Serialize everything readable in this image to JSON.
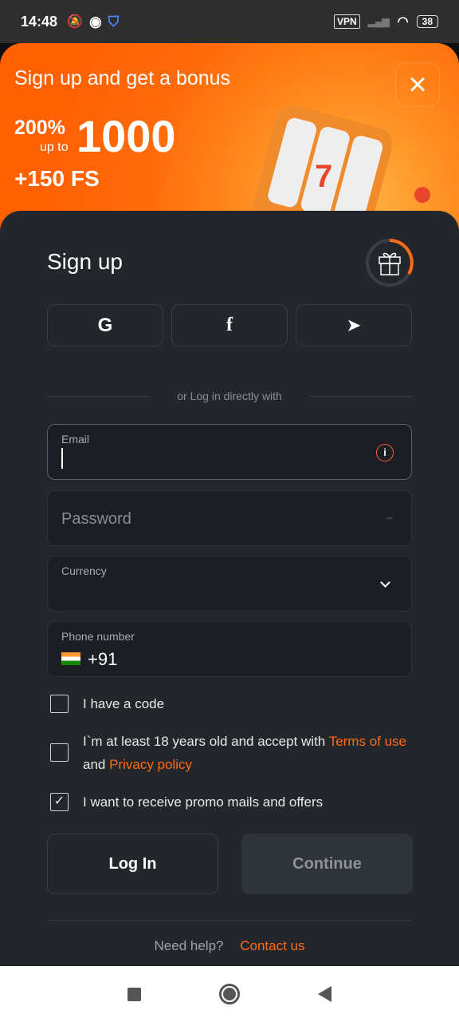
{
  "status_bar": {
    "time": "14:48",
    "vpn": "VPN",
    "battery": "38"
  },
  "banner": {
    "title": "Sign up and get a bonus",
    "percent": "200%",
    "up_to": "up to",
    "amount": "1000",
    "free_spins": "+150 FS",
    "close": "×"
  },
  "form": {
    "title": "Sign up",
    "social": [
      {
        "icon": "google-icon",
        "glyph": "G"
      },
      {
        "icon": "facebook-icon",
        "glyph": "f"
      },
      {
        "icon": "telegram-icon",
        "glyph": "➤"
      }
    ],
    "divider": "or Log in directly with",
    "email": {
      "label": "Email",
      "value": ""
    },
    "password": {
      "placeholder": "Password"
    },
    "currency": {
      "label": "Currency",
      "value": ""
    },
    "phone": {
      "label": "Phone number",
      "code": "+91"
    },
    "have_code": {
      "label": "I have a code",
      "checked": false
    },
    "age": {
      "text": "I`m at least 18 years old and accept with ",
      "terms": "Terms of use",
      "and": " and ",
      "privacy": "Privacy policy",
      "checked": false
    },
    "promo": {
      "label": "I want to receive promo mails and offers",
      "checked": true
    },
    "login_button": "Log In",
    "continue_button": "Continue",
    "help": "Need help?",
    "contact": "Contact us"
  },
  "colors": {
    "accent": "#ff6a14",
    "card": "#23272c",
    "field": "#1b1e22"
  }
}
